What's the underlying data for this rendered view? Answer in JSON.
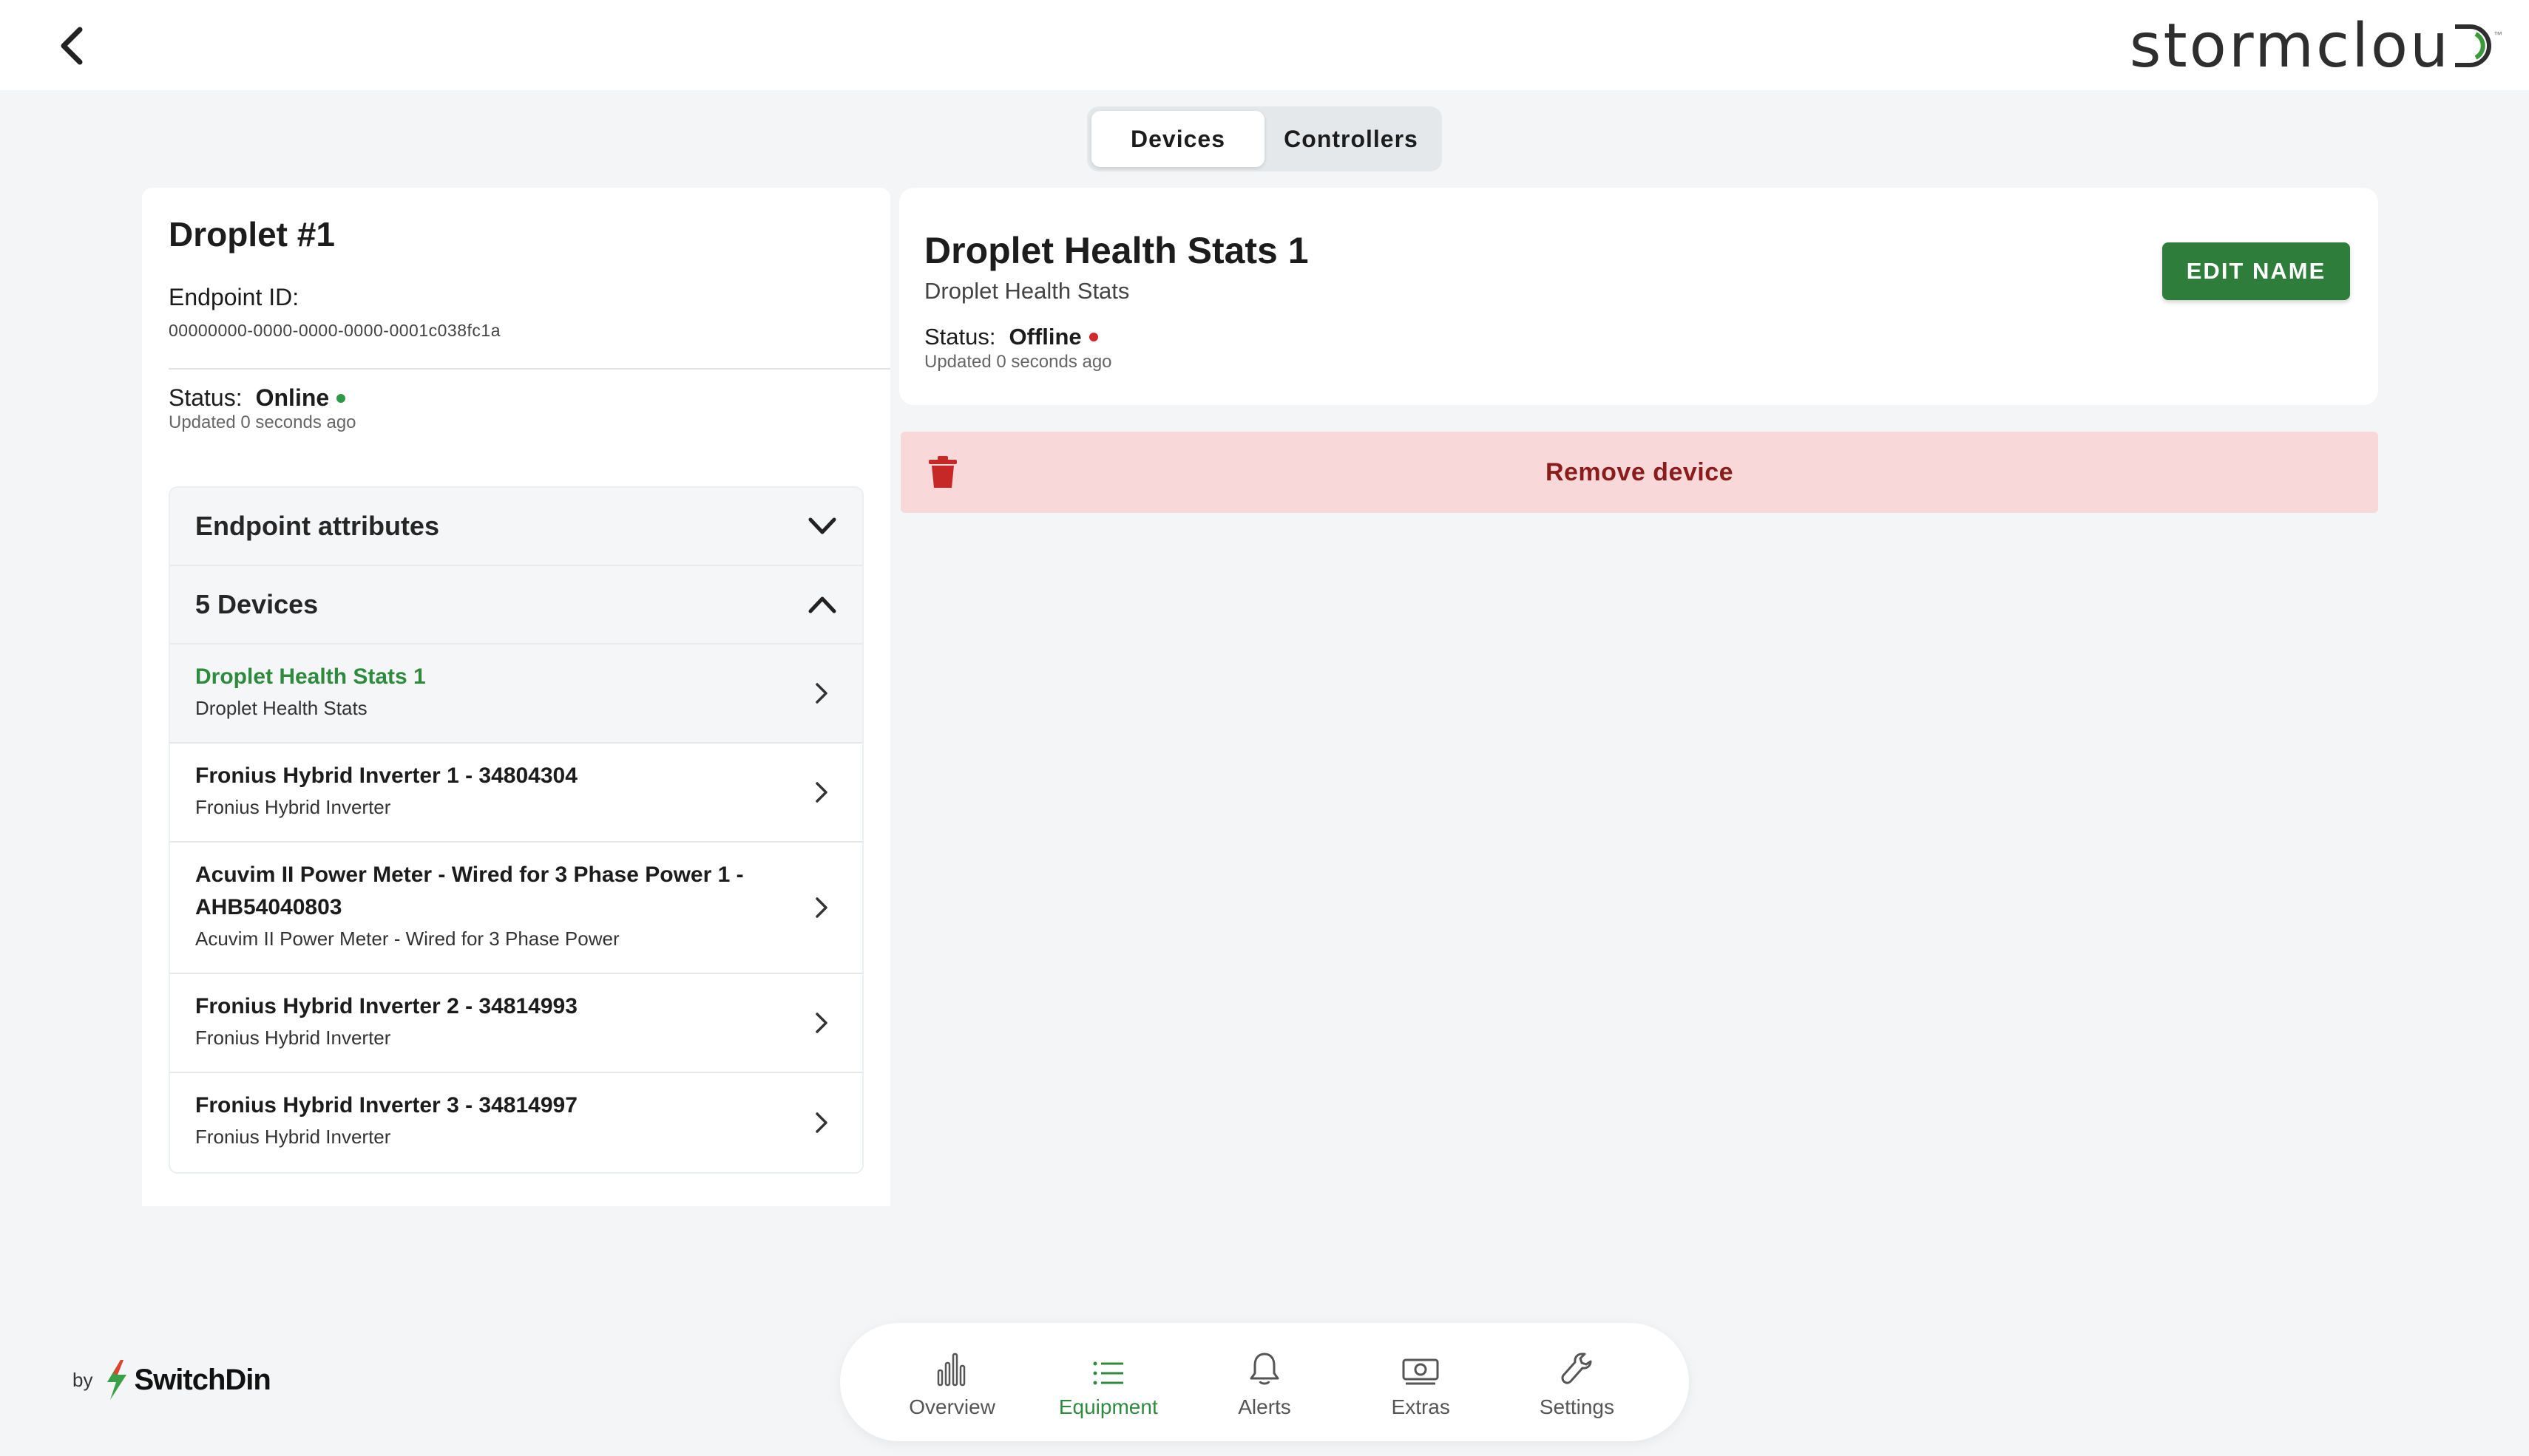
{
  "header": {
    "back_icon": "chevron-left-icon",
    "logo_text": "stormclou",
    "logo_tm": "™"
  },
  "segmented": {
    "devices_label": "Devices",
    "controllers_label": "Controllers",
    "active": "Devices"
  },
  "endpoint": {
    "title": "Droplet #1",
    "endpoint_id_label": "Endpoint ID:",
    "endpoint_id": "00000000-0000-0000-0000-0001c038fc1a",
    "status_label": "Status:",
    "status_value": "Online",
    "status_color": "#2e9a46",
    "updated": "Updated 0 seconds ago"
  },
  "accordion": {
    "attributes_label": "Endpoint attributes",
    "devices_label": "5 Devices",
    "devices": [
      {
        "name": "Droplet Health Stats 1",
        "type": "Droplet Health Stats",
        "selected": true
      },
      {
        "name": "Fronius Hybrid Inverter 1 - 34804304",
        "type": "Fronius Hybrid Inverter",
        "selected": false
      },
      {
        "name": "Acuvim II Power Meter - Wired for 3 Phase Power 1 - AHB54040803",
        "type": "Acuvim II Power Meter - Wired for 3 Phase Power",
        "selected": false
      },
      {
        "name": "Fronius Hybrid Inverter 2 - 34814993",
        "type": "Fronius Hybrid Inverter",
        "selected": false
      },
      {
        "name": "Fronius Hybrid Inverter 3 - 34814997",
        "type": "Fronius Hybrid Inverter",
        "selected": false
      }
    ]
  },
  "detail": {
    "title": "Droplet Health Stats 1",
    "subtitle": "Droplet Health Stats",
    "status_label": "Status:",
    "status_value": "Offline",
    "status_color": "#d02a2a",
    "updated": "Updated 0 seconds ago",
    "edit_button": "EDIT NAME",
    "remove_label": "Remove device"
  },
  "footer": {
    "by": "by",
    "brand": "SwitchDin"
  },
  "nav": {
    "items": [
      {
        "label": "Overview",
        "icon": "bar-chart-icon"
      },
      {
        "label": "Equipment",
        "icon": "list-icon"
      },
      {
        "label": "Alerts",
        "icon": "bell-icon"
      },
      {
        "label": "Extras",
        "icon": "money-icon"
      },
      {
        "label": "Settings",
        "icon": "wrench-icon"
      }
    ],
    "active": "Equipment"
  },
  "colors": {
    "accent_green": "#2e7d3a",
    "remove_bg": "#f8d8d8",
    "remove_text": "#8a1c1c"
  }
}
